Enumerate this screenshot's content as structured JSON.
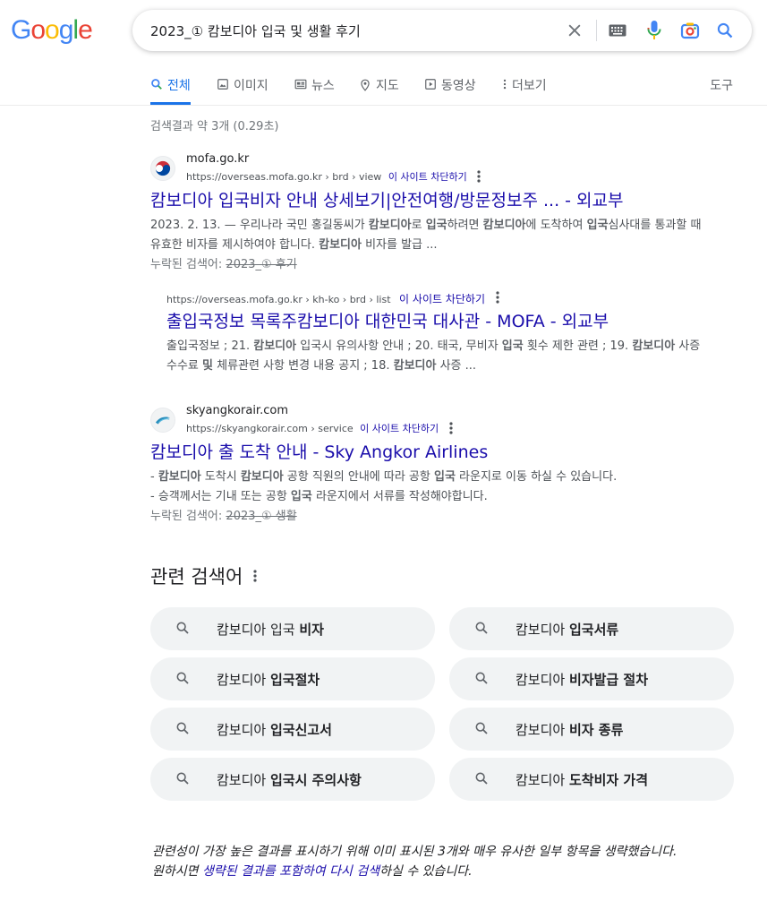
{
  "header": {
    "logo_letters": [
      {
        "ch": "G",
        "color": "#4285f4"
      },
      {
        "ch": "o",
        "color": "#ea4335"
      },
      {
        "ch": "o",
        "color": "#fbbc05"
      },
      {
        "ch": "g",
        "color": "#4285f4"
      },
      {
        "ch": "l",
        "color": "#34a853"
      },
      {
        "ch": "e",
        "color": "#ea4335"
      }
    ],
    "search_value": "2023_① 캄보디아 입국 및 생활 후기",
    "icons": [
      "close-icon",
      "keyboard-icon",
      "mic-icon",
      "camera-icon",
      "search-icon"
    ]
  },
  "tabs": [
    {
      "label": "전체",
      "icon": "search-icon"
    },
    {
      "label": "이미지",
      "icon": "image-icon"
    },
    {
      "label": "뉴스",
      "icon": "news-icon"
    },
    {
      "label": "지도",
      "icon": "map-pin-icon"
    },
    {
      "label": "동영상",
      "icon": "video-icon"
    },
    {
      "label": "더보기",
      "icon": "more-vert-icon"
    }
  ],
  "tools_label": "도구",
  "stats": "검색결과 약 3개 (0.29초)",
  "results": [
    {
      "site": "mofa.go.kr",
      "url": "https://overseas.mofa.go.kr › brd › view",
      "block": "이 사이트 차단하기",
      "title": "캄보디아 입국비자 안내 상세보기|안전여행/방문정보주 ... - 외교부",
      "snippet_html": "2023. 2. 13. — 우리나라 국민 홍길동씨가 <b>캄보디아</b>로 <b>입국</b>하려면 <b>캄보디아</b>에 도착하여 <b>입국</b>심사대를 통과할 때 유효한 비자를 제시하여야 합니다. <b>캄보디아</b> 비자를 발급 ...",
      "missing_label": "누락된 검색어:",
      "missing_terms": "2023_① 후기"
    },
    {
      "url": "https://overseas.mofa.go.kr › kh-ko › brd › list",
      "block": "이 사이트 차단하기",
      "title": "출입국정보 목록주캄보디아 대한민국 대사관 - MOFA - 외교부",
      "snippet_html": "출입국정보 ; 21. <b>캄보디아</b> 입국시 유의사항 안내 ; 20. 태국, 무비자 <b>입국</b> 횟수 제한 관련 ; 19. <b>캄보디아</b> 사증 수수료 <b>및</b> 체류관련 사항 변경 내용 공지 ; 18. <b>캄보디아</b> 사증 ..."
    },
    {
      "site": "skyangkorair.com",
      "url": "https://skyangkorair.com › service",
      "block": "이 사이트 차단하기",
      "title": "캄보디아 출 도착 안내 - Sky Angkor Airlines",
      "snippet_html": "- <b>캄보디아</b> 도착시 <b>캄보디아</b> 공항 직원의 안내에 따라 공항 <b>입국</b> 라운지로 이동 하실 수 있습니다.<br>- 승객께서는 기내 또는 공항 <b>입국</b> 라운지에서 서류를 작성해야합니다.",
      "missing_label": "누락된 검색어:",
      "missing_terms": "2023_① 생활"
    }
  ],
  "related": {
    "title": "관련 검색어",
    "items": [
      {
        "plain": "캄보디아 입국 ",
        "bold": "비자"
      },
      {
        "plain": "캄보디아 ",
        "bold": "입국서류"
      },
      {
        "plain": "캄보디아 ",
        "bold": "입국절차"
      },
      {
        "plain": "캄보디아 ",
        "bold": "비자발급 절차"
      },
      {
        "plain": "캄보디아 ",
        "bold": "입국신고서"
      },
      {
        "plain": "캄보디아 ",
        "bold": "비자 종류"
      },
      {
        "plain": "캄보디아 ",
        "bold": "입국시 주의사항"
      },
      {
        "plain": "캄보디아 ",
        "bold": "도착비자 가격"
      }
    ]
  },
  "omitted": {
    "line1": "관련성이 가장 높은 결과를 표시하기 위해 이미 표시된 3개와 매우 유사한 일부 항목을 생략했습니다.",
    "line2_prefix": "원하시면 ",
    "line2_link": "생략된 결과를 포함하여 다시 검색",
    "line2_suffix": "하실 수 있습니다."
  }
}
